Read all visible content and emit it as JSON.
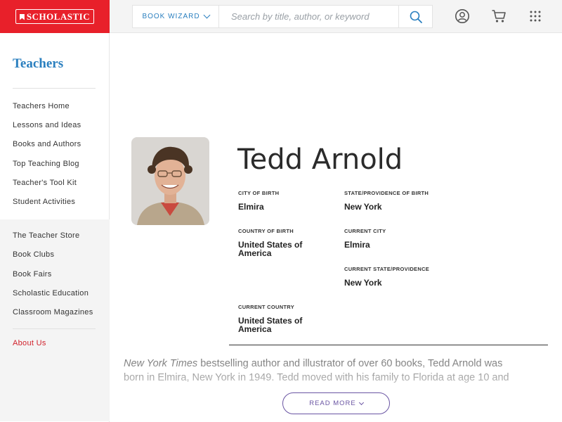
{
  "header": {
    "logo_text": "SCHOLASTIC",
    "book_wizard_label": "BOOK WIZARD",
    "search_placeholder": "Search by title, author, or keyword",
    "icons": [
      "search-icon",
      "account-icon",
      "cart-icon",
      "apps-grid-icon"
    ]
  },
  "sidebar": {
    "title": "Teachers",
    "group1": [
      "Teachers Home",
      "Lessons and Ideas",
      "Books and Authors",
      "Top Teaching Blog",
      "Teacher's Tool Kit",
      "Student Activities"
    ],
    "group2": [
      "The Teacher Store",
      "Book Clubs",
      "Book Fairs",
      "Scholastic Education",
      "Classroom Magazines"
    ],
    "about": "About Us"
  },
  "author": {
    "name": "Tedd Arnold",
    "fields": {
      "city_of_birth": {
        "label": "CITY OF BIRTH",
        "value": "Elmira"
      },
      "state_of_birth": {
        "label": "STATE/PROVIDENCE OF BIRTH",
        "value": "New York"
      },
      "country_of_birth": {
        "label": "COUNTRY OF BIRTH",
        "value": "United States of America"
      },
      "current_city": {
        "label": "CURRENT CITY",
        "value": "Elmira"
      },
      "current_state": {
        "label": "CURRENT STATE/PROVIDENCE",
        "value": "New York"
      },
      "current_country": {
        "label": "CURRENT COUNTRY",
        "value": "United States of America"
      }
    },
    "bio_em": "New York Times",
    "bio_rest": " bestselling author and illustrator of over 60 books, Tedd Arnold was born in Elmira, New York in 1949. Tedd moved with his family to Florida at age 10 and",
    "read_more": "READ MORE"
  },
  "colors": {
    "brand_red": "#e8202a",
    "link_blue": "#2a7fbf",
    "button_purple": "#6a55a3"
  }
}
